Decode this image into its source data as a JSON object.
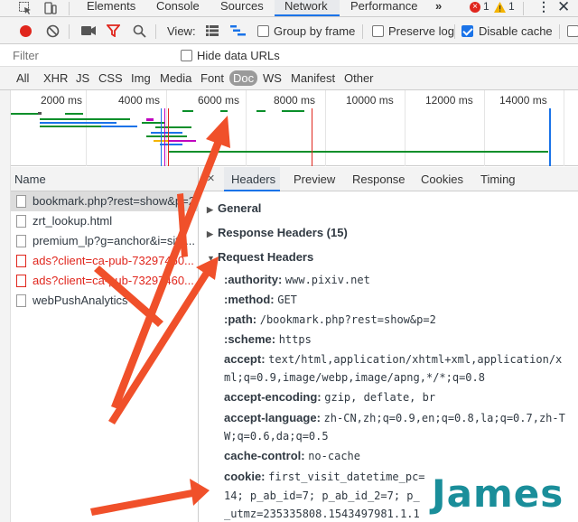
{
  "top_tabs": [
    "Elements",
    "Console",
    "Sources",
    "Network",
    "Performance"
  ],
  "more_tabs_glyph": "»",
  "error_count": "1",
  "warning_count": "1",
  "colors": {
    "accent": "#1a73e8",
    "error": "#e0261d",
    "arrow": "#f0502a",
    "watermark": "#1a8e9a"
  },
  "toolbar": {
    "view_label": "View:",
    "group_by_frame": "Group by frame",
    "preserve_log": "Preserve log",
    "disable_cache": "Disable cache",
    "disable_cache_checked": true
  },
  "filter": {
    "placeholder": "Filter",
    "hide_data_urls": "Hide data URLs"
  },
  "types": [
    "All",
    "XHR",
    "JS",
    "CSS",
    "Img",
    "Media",
    "Font",
    "Doc",
    "WS",
    "Manifest",
    "Other"
  ],
  "selected_type": "Doc",
  "timeline_ticks": [
    "2000 ms",
    "4000 ms",
    "6000 ms",
    "8000 ms",
    "10000 ms",
    "12000 ms",
    "14000 ms"
  ],
  "request_list": {
    "header": "Name",
    "items": [
      {
        "name": "bookmark.php?rest=show&p=2",
        "error": false,
        "selected": true
      },
      {
        "name": "zrt_lookup.html",
        "error": false,
        "selected": false
      },
      {
        "name": "premium_lp?g=anchor&i=site...",
        "error": false,
        "selected": false
      },
      {
        "name": "ads?client=ca-pub-73297460...",
        "error": true,
        "selected": false
      },
      {
        "name": "ads?client=ca-pub-73297460...",
        "error": true,
        "selected": false
      },
      {
        "name": "webPushAnalytics",
        "error": false,
        "selected": false
      }
    ]
  },
  "detail_tabs": [
    "Headers",
    "Preview",
    "Response",
    "Cookies",
    "Timing"
  ],
  "close_glyph": "×",
  "sections": {
    "general": "General",
    "response_headers": "Response Headers (15)",
    "request_headers": "Request Headers"
  },
  "request_headers": [
    {
      "k": ":authority:",
      "v": "www.pixiv.net"
    },
    {
      "k": ":method:",
      "v": "GET"
    },
    {
      "k": ":path:",
      "v": "/bookmark.php?rest=show&p=2"
    },
    {
      "k": ":scheme:",
      "v": "https"
    },
    {
      "k": "accept:",
      "v": "text/html,application/xhtml+xml,application/x"
    },
    {
      "k": "",
      "v": "ml;q=0.9,image/webp,image/apng,*/*;q=0.8"
    },
    {
      "k": "accept-encoding:",
      "v": "gzip, deflate, br"
    },
    {
      "k": "accept-language:",
      "v": "zh-CN,zh;q=0.9,en;q=0.8,la;q=0.7,zh-T"
    },
    {
      "k": "",
      "v": "W;q=0.6,da;q=0.5"
    },
    {
      "k": "cache-control:",
      "v": "no-cache"
    },
    {
      "k": "cookie:",
      "v": "first_visit_datetime_pc="
    },
    {
      "k": "",
      "v": "14; p_ab_id=7; p_ab_id_2=7; p_"
    },
    {
      "k": "",
      "v": "_utmz=235335808.1543497981.1.1"
    }
  ],
  "watermark": "James"
}
